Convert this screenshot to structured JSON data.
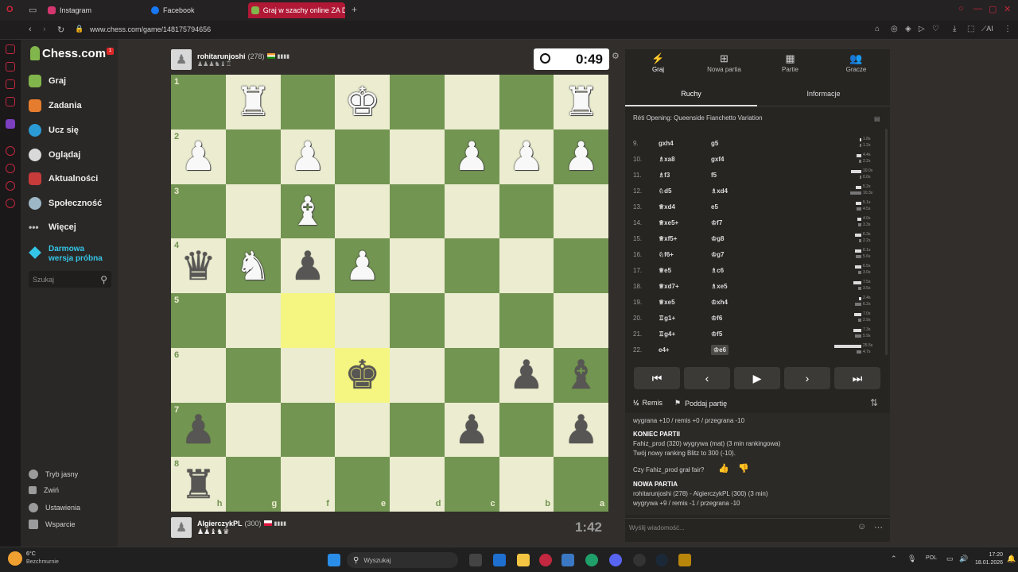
{
  "browser": {
    "tabs": [
      {
        "label": "Instagram",
        "color": "#d6366f"
      },
      {
        "label": "Facebook",
        "color": "#1877f2"
      },
      {
        "label": "Graj w szachy online ZA D",
        "color": "#81b64c"
      }
    ],
    "url": "www.chess.com/game/148175794656"
  },
  "sidebar": {
    "logo": "Chess.com",
    "badge": "1",
    "items": [
      {
        "label": "Graj",
        "color": "#81b64c"
      },
      {
        "label": "Zadania",
        "color": "#e57c2e"
      },
      {
        "label": "Ucz się",
        "color": "#2b9bd6"
      },
      {
        "label": "Oglądaj",
        "color": "#d9d9d9"
      },
      {
        "label": "Aktualności",
        "color": "#c73b3b"
      },
      {
        "label": "Społeczność",
        "color": "#9db7c7"
      },
      {
        "label": "Więcej",
        "color": "#bdbdbd"
      }
    ],
    "trial_line1": "Darmowa",
    "trial_line2": "wersja próbna",
    "search_placeholder": "Szukaj",
    "footer": [
      "Tryb jasny",
      "Zwiń",
      "Ustawienia",
      "Wsparcie"
    ]
  },
  "top_player": {
    "name": "rohitarunjoshi",
    "rating": "(278)",
    "clock": "0:49"
  },
  "bottom_player": {
    "name": "AlgierczykPL",
    "rating": "(300)",
    "clock": "1:42"
  },
  "board": {
    "files": [
      "h",
      "g",
      "f",
      "e",
      "d",
      "c",
      "b",
      "a"
    ],
    "ranks": [
      "1",
      "2",
      "3",
      "4",
      "5",
      "6",
      "7",
      "8"
    ],
    "highlighted": [
      "f5",
      "e6"
    ],
    "pieces": [
      {
        "sq": "g1",
        "p": "♜",
        "c": "w"
      },
      {
        "sq": "e1",
        "p": "♚",
        "c": "w"
      },
      {
        "sq": "a1",
        "p": "♜",
        "c": "w"
      },
      {
        "sq": "h2",
        "p": "♟",
        "c": "w"
      },
      {
        "sq": "f2",
        "p": "♟",
        "c": "w"
      },
      {
        "sq": "c2",
        "p": "♟",
        "c": "w"
      },
      {
        "sq": "b2",
        "p": "♟",
        "c": "w"
      },
      {
        "sq": "a2",
        "p": "♟",
        "c": "w"
      },
      {
        "sq": "f3",
        "p": "♝",
        "c": "w"
      },
      {
        "sq": "h4",
        "p": "♛",
        "c": "b"
      },
      {
        "sq": "g4",
        "p": "♞",
        "c": "w"
      },
      {
        "sq": "f4",
        "p": "♟",
        "c": "b"
      },
      {
        "sq": "e4",
        "p": "♟",
        "c": "w"
      },
      {
        "sq": "e6",
        "p": "♚",
        "c": "b"
      },
      {
        "sq": "b6",
        "p": "♟",
        "c": "b"
      },
      {
        "sq": "a6",
        "p": "♝",
        "c": "b"
      },
      {
        "sq": "h7",
        "p": "♟",
        "c": "b"
      },
      {
        "sq": "c7",
        "p": "♟",
        "c": "b"
      },
      {
        "sq": "a7",
        "p": "♟",
        "c": "b"
      },
      {
        "sq": "h8",
        "p": "♜",
        "c": "b"
      }
    ]
  },
  "panel": {
    "tabs": [
      {
        "label": "Graj",
        "icon": "⚡"
      },
      {
        "label": "Nowa partia",
        "icon": "⊞"
      },
      {
        "label": "Partie",
        "icon": "▦"
      },
      {
        "label": "Gracze",
        "icon": "👥"
      }
    ],
    "subtabs": [
      "Ruchy",
      "Informacje"
    ],
    "opening": "Réti Opening: Queenside Fianchetto Variation",
    "moves": [
      {
        "n": "9.",
        "w": "gxh4",
        "b": "g5",
        "t1": "1.8s",
        "t2": "1.2s",
        "v1": 0.05,
        "v2": 0.03
      },
      {
        "n": "10.",
        "w": "♗xa8",
        "b": "gxf4",
        "t1": "4.4s",
        "t2": "2.2s",
        "v1": 0.17,
        "v2": 0.08
      },
      {
        "n": "11.",
        "w": "♗f3",
        "b": "f5",
        "t1": "10.0s",
        "t2": "0.0s",
        "v1": 0.39,
        "v2": 0.0
      },
      {
        "n": "12.",
        "w": "♘d5",
        "b": "♗xd4",
        "t1": "5.2s",
        "t2": "10.3s",
        "v1": 0.2,
        "v2": 0.4
      },
      {
        "n": "13.",
        "w": "♕xd4",
        "b": "e5",
        "t1": "5.1s",
        "t2": "4.5s",
        "v1": 0.2,
        "v2": 0.17
      },
      {
        "n": "14.",
        "w": "♕xe5+",
        "b": "♔f7",
        "t1": "4.0s",
        "t2": "3.3s",
        "v1": 0.15,
        "v2": 0.13
      },
      {
        "n": "15.",
        "w": "♕xf5+",
        "b": "♔g8",
        "t1": "6.3s",
        "t2": "2.2s",
        "v1": 0.24,
        "v2": 0.08
      },
      {
        "n": "16.",
        "w": "♘f6+",
        "b": "♔g7",
        "t1": "6.1s",
        "t2": "5.6s",
        "v1": 0.24,
        "v2": 0.22
      },
      {
        "n": "17.",
        "w": "♕e5",
        "b": "♗c6",
        "t1": "6.5s",
        "t2": "3.0s",
        "v1": 0.25,
        "v2": 0.11
      },
      {
        "n": "18.",
        "w": "♕xd7+",
        "b": "♗xe5",
        "t1": "7.5s",
        "t2": "3.5s",
        "v1": 0.29,
        "v2": 0.13
      },
      {
        "n": "19.",
        "w": "♕xe5",
        "b": "♔xh4",
        "t1": "2.4s",
        "t2": "6.2s",
        "v1": 0.09,
        "v2": 0.24
      },
      {
        "n": "20.",
        "w": "♖g1+",
        "b": "♔f6",
        "t1": "7.0s",
        "t2": "2.9s",
        "v1": 0.27,
        "v2": 0.11
      },
      {
        "n": "21.",
        "w": "♖g4+",
        "b": "♔f5",
        "t1": "7.3s",
        "t2": "5.9s",
        "v1": 0.28,
        "v2": 0.23
      },
      {
        "n": "22.",
        "w": "e4+",
        "b": "♔e6",
        "t1": "25.5s",
        "t2": "4.7s",
        "v1": 1.0,
        "v2": 0.18
      }
    ],
    "nav": [
      "⏮",
      "‹",
      "▶",
      "›",
      "⏭"
    ],
    "draw_label": "Remis",
    "resign_label": "Poddaj partię",
    "draw_icon": "½",
    "log": {
      "line0": "wygrana +10 / remis +0 / przegrana -10",
      "end_title": "KONIEC PARTII",
      "end_line1": "Fahiz_prod (320) wygrywa (mat) (3 min rankingowa)",
      "end_line2": "Twój nowy ranking Blitz to 300 (-10).",
      "fair_q": "Czy Fahiz_prod grał fair?",
      "new_title": "NOWA PARTIA",
      "new_line1": "rohitarunjoshi (278) - AlgierczykPL (300) (3 min)",
      "new_line2": "wygrywa +9 / remis -1 / przegrana -10"
    },
    "chat_placeholder": "Wyślij wiadomość..."
  },
  "taskbar": {
    "weather_temp": "6°C",
    "weather_desc": "Bezchmurnie",
    "search_placeholder": "Wyszukaj",
    "lang": "POL",
    "time": "17:20",
    "date": "18.01.2026"
  }
}
